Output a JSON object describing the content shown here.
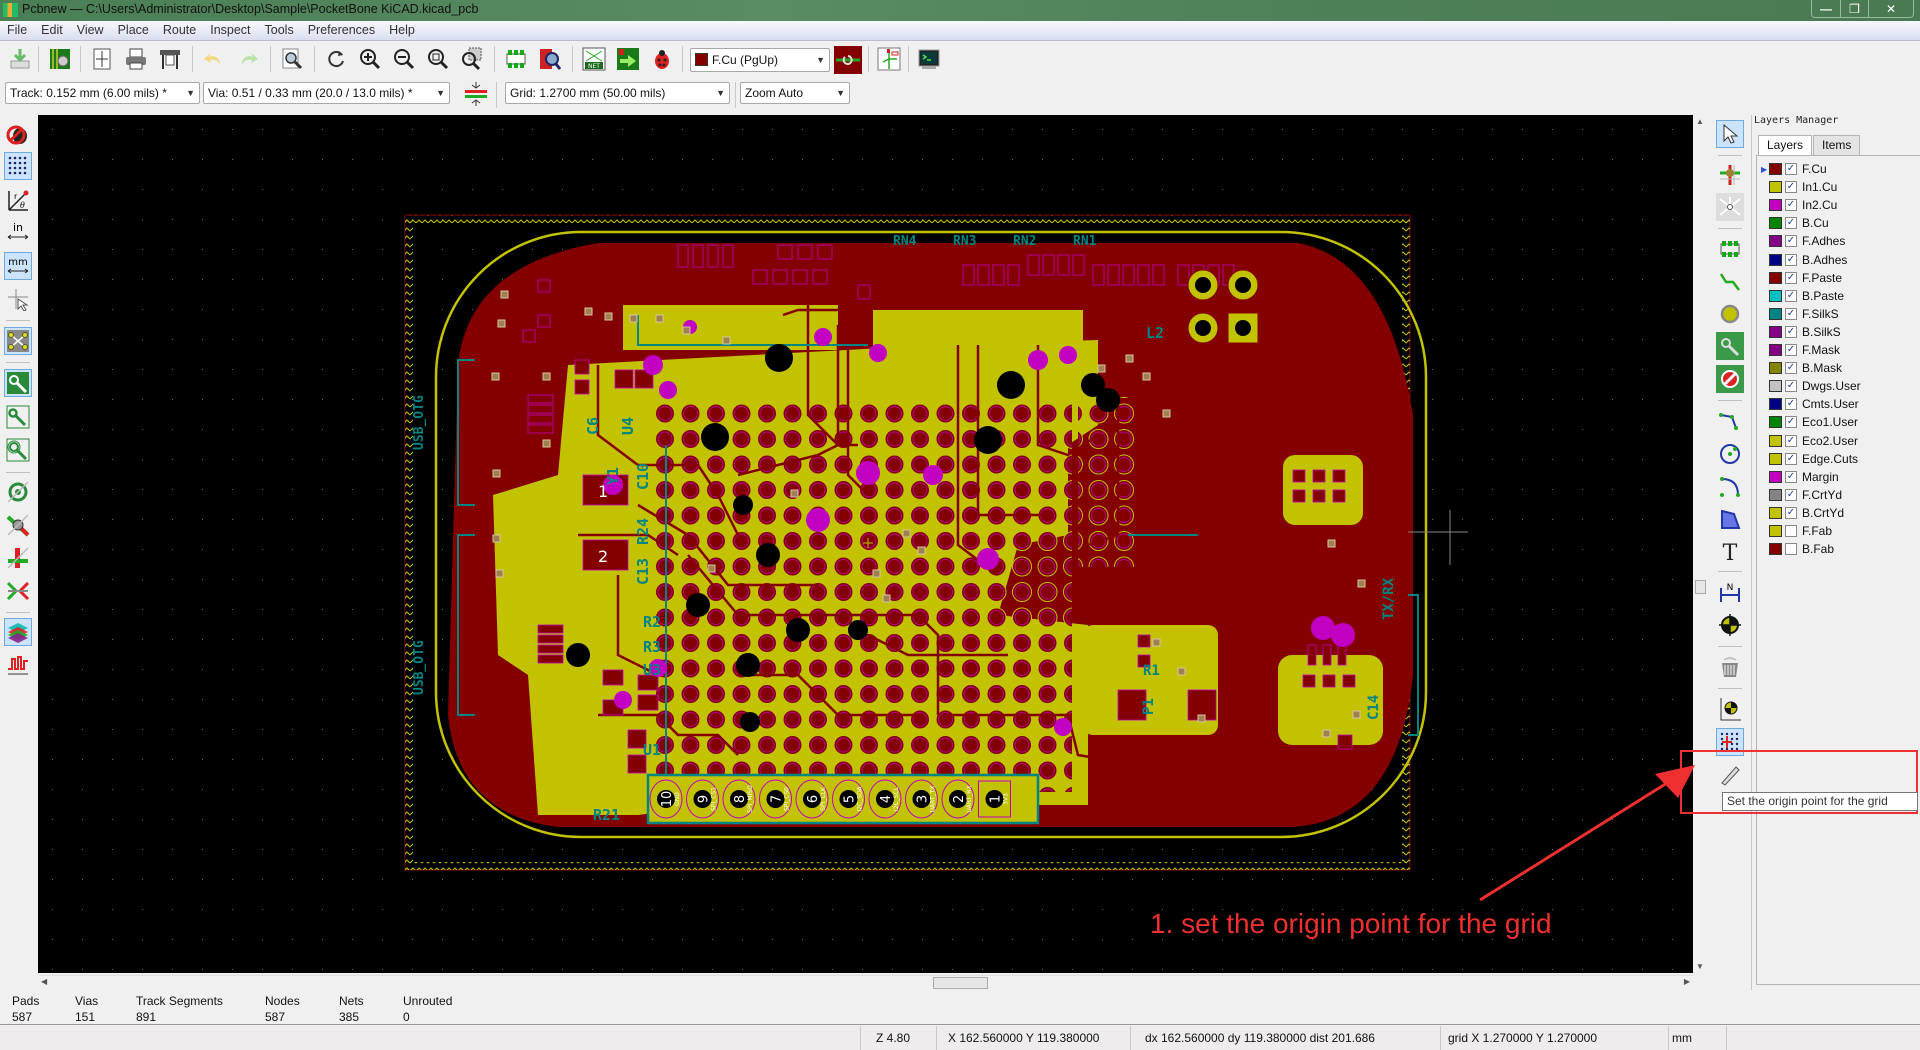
{
  "window": {
    "title": "Pcbnew — C:\\Users\\Administrator\\Desktop\\Sample\\PocketBone KiCAD.kicad_pcb",
    "controls": {
      "minimize": "—",
      "restore": "❐",
      "close": "✕"
    }
  },
  "menu": [
    "File",
    "Edit",
    "View",
    "Place",
    "Route",
    "Inspect",
    "Tools",
    "Preferences",
    "Help"
  ],
  "toolbar_main": {
    "icons": [
      "save-board-icon",
      "board-setup-icon",
      "page-settings-icon",
      "print-icon",
      "plot-icon",
      "undo-icon",
      "redo-icon",
      "find-icon",
      "redraw-icon",
      "zoom-in-icon",
      "zoom-out-icon",
      "zoom-fit-icon",
      "zoom-selection-icon",
      "footprint-editor-icon",
      "footprint-viewer-icon",
      "netlist-icon",
      "update-pcb-icon",
      "drc-icon",
      "layer-pair-icon",
      "eeschema-icon",
      "scripting-console-icon"
    ],
    "active_layer": "F.Cu (PgUp)",
    "active_layer_color": "#840000"
  },
  "toolbar_aux": {
    "track": "Track: 0.152 mm (6.00 mils) *",
    "via": "Via: 0.51 / 0.33 mm (20.0 / 13.0 mils) *",
    "grid": "Grid: 1.2700 mm (50.00 mils)",
    "zoom": "Zoom Auto"
  },
  "left_toolbar": [
    {
      "name": "drc-off-icon",
      "active": false
    },
    {
      "name": "grid-toggle-icon",
      "active": true
    },
    {
      "name": "polar-coords-icon",
      "active": false
    },
    {
      "name": "inches-icon",
      "active": false,
      "label": "in"
    },
    {
      "name": "millimeters-icon",
      "active": true,
      "label": "mm"
    },
    {
      "name": "cursor-shape-icon",
      "active": false
    },
    {
      "name": "ratsnest-icon",
      "active": true
    },
    {
      "name": "zone-fill-icon",
      "active": true
    },
    {
      "name": "zone-outline-icon",
      "active": false
    },
    {
      "name": "zone-fill-outline-icon",
      "active": false
    },
    {
      "name": "pad-sketch-icon",
      "active": false
    },
    {
      "name": "via-sketch-icon",
      "active": false
    },
    {
      "name": "track-sketch-icon",
      "active": false
    },
    {
      "name": "high-contrast-icon",
      "active": false
    },
    {
      "name": "layers-manager-icon",
      "active": true
    },
    {
      "name": "microwave-tools-icon",
      "active": false
    }
  ],
  "right_toolbar": [
    {
      "name": "select-icon",
      "active": true
    },
    {
      "name": "highlight-net-icon",
      "active": false
    },
    {
      "name": "local-ratsnest-icon",
      "active": false
    },
    {
      "name": "add-footprint-icon",
      "active": false
    },
    {
      "name": "route-track-icon",
      "active": false
    },
    {
      "name": "add-via-icon",
      "active": false
    },
    {
      "name": "add-zone-icon",
      "active": false
    },
    {
      "name": "add-keepout-icon",
      "active": false
    },
    {
      "name": "add-line-icon",
      "active": false
    },
    {
      "name": "add-circle-icon",
      "active": false
    },
    {
      "name": "add-arc-icon",
      "active": false
    },
    {
      "name": "add-polygon-icon",
      "active": false
    },
    {
      "name": "add-text-icon",
      "active": false
    },
    {
      "name": "add-dimension-icon",
      "active": false
    },
    {
      "name": "add-target-icon",
      "active": false
    },
    {
      "name": "delete-icon",
      "active": false
    },
    {
      "name": "drill-origin-icon",
      "active": false
    },
    {
      "name": "grid-origin-icon",
      "active": true
    },
    {
      "name": "measure-icon",
      "active": false
    }
  ],
  "layers_manager": {
    "title": "Layers Manager",
    "tabs": [
      "Layers",
      "Items"
    ],
    "active_tab": "Layers",
    "layers": [
      {
        "name": "F.Cu",
        "color": "#840000",
        "visible": true,
        "selected": true
      },
      {
        "name": "In1.Cu",
        "color": "#c2c200",
        "visible": true
      },
      {
        "name": "In2.Cu",
        "color": "#c200c2",
        "visible": true
      },
      {
        "name": "B.Cu",
        "color": "#008400",
        "visible": true
      },
      {
        "name": "F.Adhes",
        "color": "#840084",
        "visible": true
      },
      {
        "name": "B.Adhes",
        "color": "#000084",
        "visible": true
      },
      {
        "name": "F.Paste",
        "color": "#840000",
        "visible": true
      },
      {
        "name": "B.Paste",
        "color": "#00c2c2",
        "visible": true
      },
      {
        "name": "F.SilkS",
        "color": "#008484",
        "visible": true
      },
      {
        "name": "B.SilkS",
        "color": "#840084",
        "visible": true
      },
      {
        "name": "F.Mask",
        "color": "#840084",
        "visible": true
      },
      {
        "name": "B.Mask",
        "color": "#848400",
        "visible": true
      },
      {
        "name": "Dwgs.User",
        "color": "#c2c2c2",
        "visible": true
      },
      {
        "name": "Cmts.User",
        "color": "#000084",
        "visible": true
      },
      {
        "name": "Eco1.User",
        "color": "#008400",
        "visible": true
      },
      {
        "name": "Eco2.User",
        "color": "#c2c200",
        "visible": true
      },
      {
        "name": "Edge.Cuts",
        "color": "#c2c200",
        "visible": true
      },
      {
        "name": "Margin",
        "color": "#c200c2",
        "visible": true
      },
      {
        "name": "F.CrtYd",
        "color": "#848484",
        "visible": true
      },
      {
        "name": "B.CrtYd",
        "color": "#c2c200",
        "visible": true
      },
      {
        "name": "F.Fab",
        "color": "#c2c200",
        "visible": false
      },
      {
        "name": "B.Fab",
        "color": "#840000",
        "visible": false
      }
    ]
  },
  "board": {
    "silk_labels": [
      "USB_OTG",
      "USB_OTG",
      "C6",
      "U4",
      "Y1",
      "R24",
      "C10",
      "C13",
      "R2",
      "R3",
      "U3",
      "U1",
      "R21",
      "RN4",
      "RN3",
      "RN2",
      "RN1",
      "L2",
      "P1",
      "R1",
      "C14",
      "TX/RX"
    ],
    "crystal_pads": [
      "1",
      "2"
    ],
    "header_pins": [
      {
        "num": "10",
        "net": "GND"
      },
      {
        "num": "9",
        "net": "SPI_CS1"
      },
      {
        "num": "8",
        "net": "SPI_MISO"
      },
      {
        "num": "7",
        "net": "SPI_CS0"
      },
      {
        "num": "6",
        "net": "SPI_CLK"
      },
      {
        "num": "5",
        "net": "I2C_SDA"
      },
      {
        "num": "4",
        "net": "I2C_SCL"
      },
      {
        "num": "3",
        "net": "UART_TX"
      },
      {
        "num": "2",
        "net": "UART_RX"
      },
      {
        "num": "1",
        "net": "3V3"
      }
    ],
    "colors": {
      "canvas": "#000000",
      "fcu": "#840000",
      "in1cu": "#c2c200",
      "in2cu": "#c200c2",
      "bcu": "#008400",
      "silk": "#008484",
      "edge": "#c2c200",
      "via": "#a08050"
    }
  },
  "messages": {
    "columns": [
      {
        "label": "Pads",
        "value": "587"
      },
      {
        "label": "Vias",
        "value": "151"
      },
      {
        "label": "Track Segments",
        "value": "891"
      },
      {
        "label": "Nodes",
        "value": "587"
      },
      {
        "label": "Nets",
        "value": "385"
      },
      {
        "label": "Unrouted",
        "value": "0"
      }
    ]
  },
  "status": {
    "zoom": "Z 4.80",
    "abs_coords": "X 162.560000  Y 119.380000",
    "rel_coords": "dx 162.560000  dy 119.380000  dist 201.686",
    "grid": "grid X 1.270000  Y 1.270000",
    "units": "mm"
  },
  "tooltip": "Set the origin point for the grid",
  "annotation": {
    "text": "1. set the origin point for the grid",
    "color": "#f03030"
  }
}
